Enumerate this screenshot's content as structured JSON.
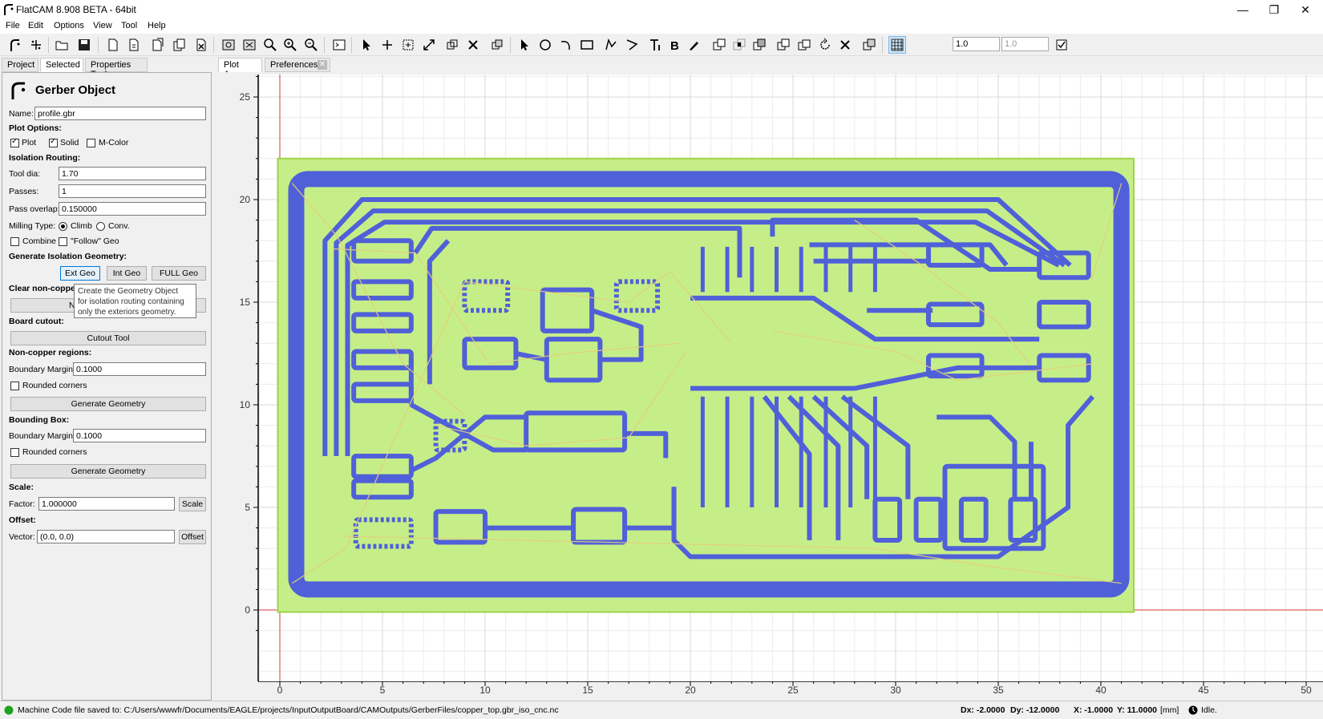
{
  "window": {
    "title": "FlatCAM 8.908 BETA - 64bit",
    "minimize": "—",
    "maximize": "❐",
    "close": "✕"
  },
  "menu": [
    "File",
    "Edit",
    "Options",
    "View",
    "Tool",
    "Help"
  ],
  "toolbar": {
    "grid_x": "1.0",
    "grid_y": "1.0"
  },
  "left_tabs": [
    "Project",
    "Selected",
    "Properties Tool"
  ],
  "right_tabs": [
    "Plot Area",
    "Preferences"
  ],
  "panel": {
    "title": "Gerber Object",
    "name_label": "Name:",
    "name_value": "profile.gbr",
    "plot_options": "Plot Options:",
    "plot": "Plot",
    "solid": "Solid",
    "mcolor": "M-Color",
    "isolation_routing": "Isolation Routing:",
    "tool_dia_label": "Tool dia:",
    "tool_dia_value": "1.70",
    "passes_label": "Passes:",
    "passes_value": "1",
    "overlap_label": "Pass overlap:",
    "overlap_value": "0.150000",
    "milling_label": "Milling Type:",
    "climb": "Climb",
    "conv": "Conv.",
    "combine": "Combine",
    "follow": "\"Follow\" Geo",
    "gen_iso": "Generate Isolation Geometry:",
    "ext_geo": "Ext Geo",
    "int_geo": "Int Geo",
    "full_geo": "FULL Geo",
    "clear_noncopper": "Clear non-coppe",
    "nc_button": "N",
    "board_cutout": "Board cutout:",
    "cutout_tool": "Cutout Tool",
    "noncopper_regions": "Non-copper regions:",
    "boundary_margin_label": "Boundary Margin:",
    "nc_margin_value": "0.1000",
    "rounded_corners": "Rounded corners",
    "generate_geometry": "Generate Geometry",
    "bounding_box": "Bounding Box:",
    "bb_margin_value": "0.1000",
    "scale": "Scale:",
    "factor_label": "Factor:",
    "factor_value": "1.000000",
    "scale_btn": "Scale",
    "offset": "Offset:",
    "vector_label": "Vector:",
    "vector_value": "(0.0, 0.0)",
    "offset_btn": "Offset",
    "tooltip": [
      "Create the Geometry Object",
      "for isolation routing containing",
      "only the exteriors geometry."
    ]
  },
  "plot": {
    "x_ticks": [
      "0",
      "5",
      "10",
      "15",
      "20",
      "25",
      "30",
      "35",
      "40",
      "45",
      "50"
    ],
    "y_ticks": [
      "0",
      "5",
      "10",
      "15",
      "20",
      "25"
    ],
    "board_fill": "#c6ee88",
    "trace_color": "#5060d8"
  },
  "status": {
    "message": "Machine Code file saved to: C:/Users/wwwfr/Documents/EAGLE/projects/InputOutputBoard/CAMOutputs/GerberFiles/copper_top.gbr_iso_cnc.nc",
    "dx": "Dx: -2.0000",
    "dy": "Dy: -12.0000",
    "x": "X: -1.0000",
    "y": "Y: 11.0000",
    "units": "[mm]",
    "state": "Idle."
  }
}
